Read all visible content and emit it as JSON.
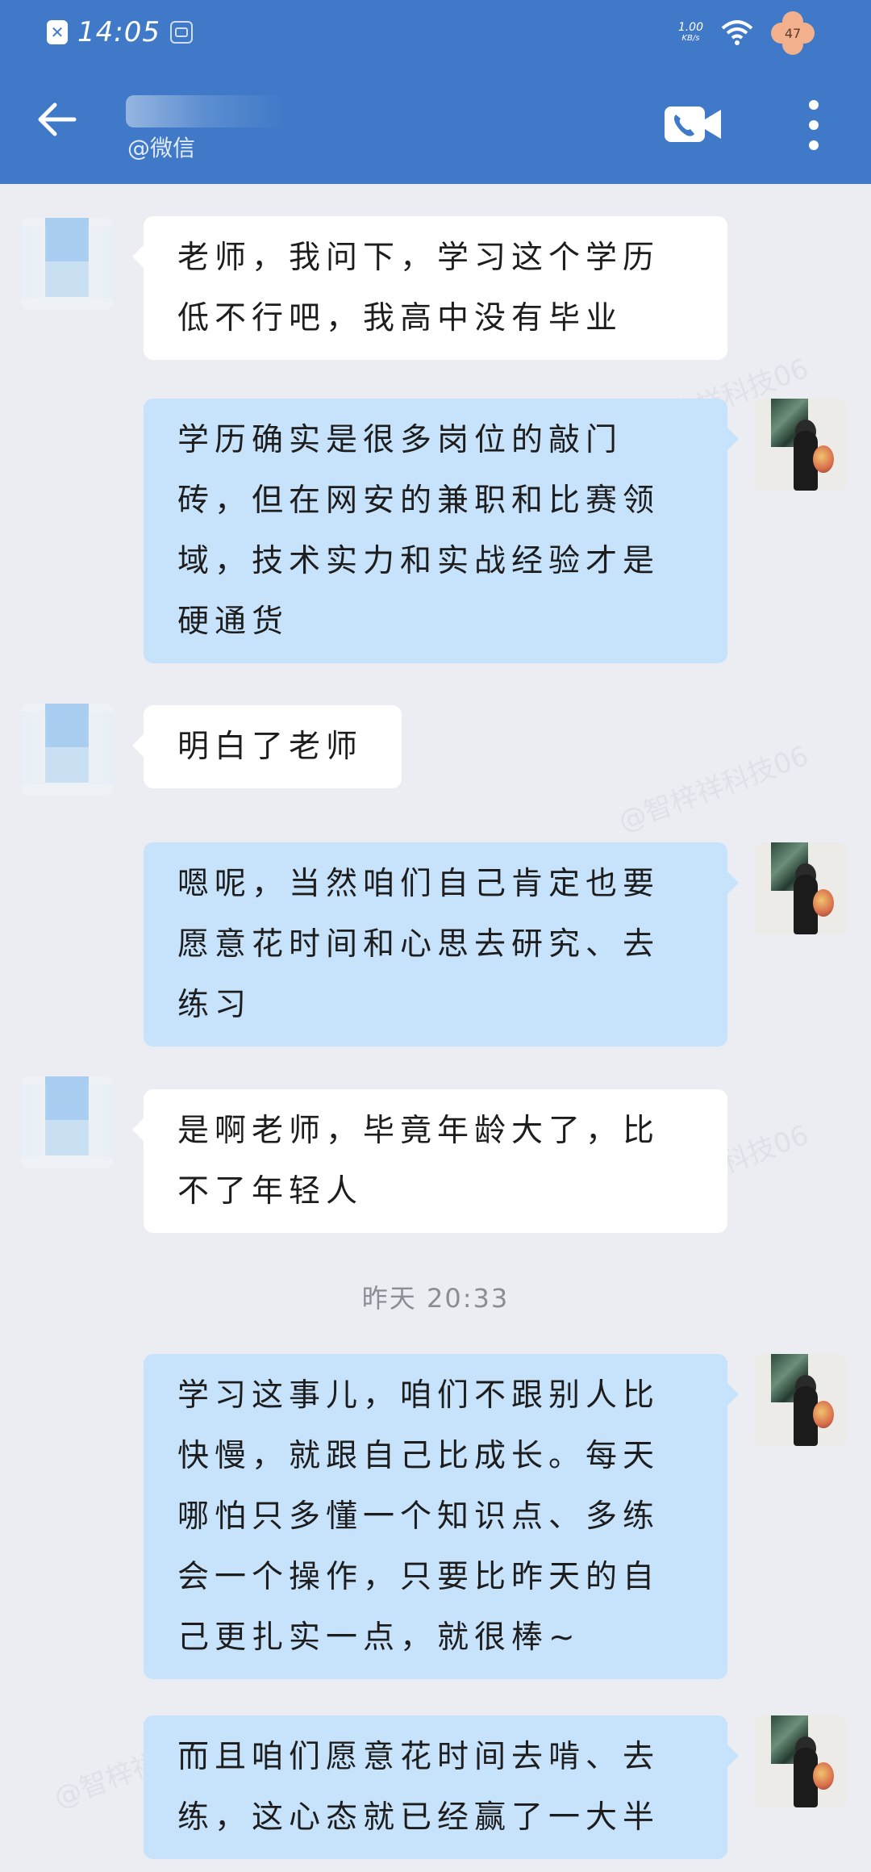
{
  "status_bar": {
    "time": "14:05",
    "net_speed": "1.00",
    "net_speed_unit": "KB/s",
    "battery": "47"
  },
  "header": {
    "subtitle": "@微信"
  },
  "messages": [
    {
      "side": "left",
      "text": "老师，我问下，学习这个学历低不行吧，我高中没有毕业"
    },
    {
      "side": "right",
      "text": "学历确实是很多岗位的敲门砖，但在网安的兼职和比赛领域，技术实力和实战经验才是硬通货"
    },
    {
      "side": "left",
      "text": "明白了老师"
    },
    {
      "side": "right",
      "text": "嗯呢，当然咱们自己肯定也要愿意花时间和心思去研究、去练习"
    },
    {
      "side": "left",
      "text": "是啊老师，毕竟年龄大了，比不了年轻人"
    },
    {
      "side": "right",
      "text": "学习这事儿，咱们不跟别人比快慢，就跟自己比成长。每天哪怕只多懂一个知识点、多练会一个操作，只要比昨天的自己更扎实一点，就很棒~"
    },
    {
      "side": "right",
      "text": "而且咱们愿意花时间去啃、去练，这心态就已经赢了一大半"
    }
  ],
  "timestamp": "昨天 20:33",
  "watermark": "@智梓祥科技06",
  "colors": {
    "header_bg": "#3f79c8",
    "chat_bg": "#ebedf2",
    "left_bubble": "#ffffff",
    "right_bubble": "#c7e2fb"
  }
}
